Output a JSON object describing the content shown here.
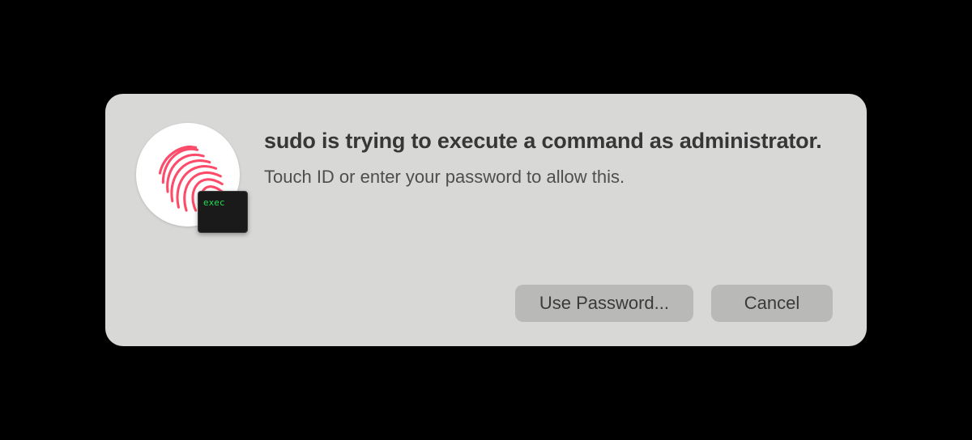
{
  "dialog": {
    "title": "sudo is trying to execute a command as administrator.",
    "subtitle": "Touch ID or enter your password to allow this.",
    "overlay_label": "exec",
    "buttons": {
      "use_password": "Use Password...",
      "cancel": "Cancel"
    },
    "colors": {
      "fingerprint": "#fd4b6a",
      "dialog_bg": "#d8d8d6",
      "button_bg": "#b9b9b7",
      "overlay_text": "#22dd55"
    }
  }
}
